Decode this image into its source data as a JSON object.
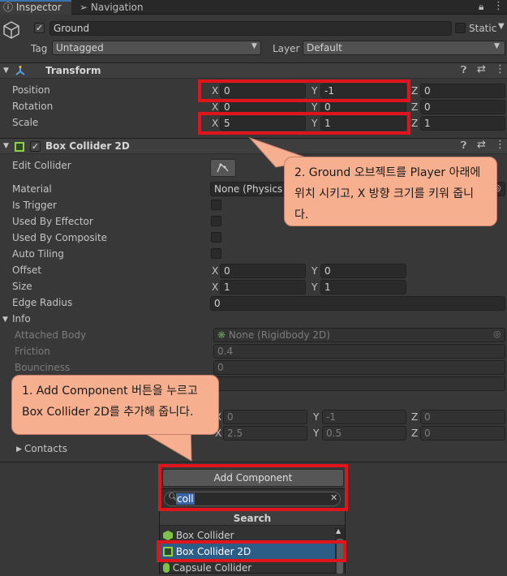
{
  "tabs": [
    {
      "label": "Inspector",
      "icon": "info-icon"
    },
    {
      "label": "Navigation",
      "icon": "navigation-icon"
    }
  ],
  "gameobject": {
    "name": "Ground",
    "static_label": "Static",
    "tag_label": "Tag",
    "tag_value": "Untagged",
    "layer_label": "Layer",
    "layer_value": "Default"
  },
  "transform": {
    "title": "Transform",
    "rows": [
      {
        "label": "Position",
        "x": "0",
        "y": "-1",
        "z": "0"
      },
      {
        "label": "Rotation",
        "x": "0",
        "y": "0",
        "z": "0"
      },
      {
        "label": "Scale",
        "x": "5",
        "y": "1",
        "z": "1"
      }
    ]
  },
  "axes": {
    "x": "X",
    "y": "Y",
    "z": "Z"
  },
  "box_collider": {
    "title": "Box Collider 2D",
    "edit_collider": "Edit Collider",
    "material_label": "Material",
    "material_value": "None (Physics M",
    "is_trigger": "Is Trigger",
    "used_by_effector": "Used By Effector",
    "used_by_composite": "Used By Composite",
    "auto_tiling": "Auto Tiling",
    "offset_label": "Offset",
    "offset_x": "0",
    "offset_y": "0",
    "size_label": "Size",
    "size_x": "1",
    "size_y": "1",
    "edge_radius_label": "Edge Radius",
    "edge_radius_value": "0"
  },
  "info": {
    "label": "Info",
    "attached_body_label": "Attached Body",
    "attached_body_value": "None (Rigidbody 2D)",
    "friction_label": "Friction",
    "friction_value": "0.4",
    "bounciness_label": "Bounciness",
    "bounciness_value": "0",
    "bounds_row1": {
      "x": "0",
      "y": "-1",
      "z": "0"
    },
    "bounds_row2": {
      "x": "2.5",
      "y": "0.5",
      "z": "0"
    },
    "contacts_label": "Contacts"
  },
  "callouts": {
    "callout_1": "1. Add Component 버튼을 누르고 Box Collider 2D를 추가해 줍니다.",
    "callout_2": "2. Ground 오브젝트를 Player 아래에 위치 시키고, X 방향 크기를 키워 줍니다."
  },
  "add_component": {
    "button_label": "Add Component",
    "search_value": "coll",
    "search_header": "Search",
    "results": [
      "Box Collider",
      "Box Collider 2D",
      "Capsule Collider"
    ]
  }
}
